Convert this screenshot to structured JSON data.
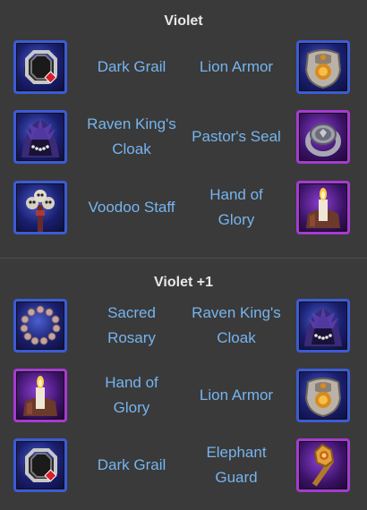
{
  "sections": [
    {
      "title": "Violet",
      "rows": [
        {
          "left": {
            "name": "Dark Grail",
            "icon": "dark-grail-icon",
            "rarity_color": "#3c5bd8"
          },
          "right": {
            "name": "Lion Armor",
            "icon": "lion-armor-icon",
            "rarity_color": "#3c5bd8"
          }
        },
        {
          "left": {
            "name": "Raven King's\nCloak",
            "icon": "raven-kings-cloak-icon",
            "rarity_color": "#3c5bd8"
          },
          "right": {
            "name": "Pastor's Seal",
            "icon": "pastors-seal-icon",
            "rarity_color": "#a63ad3"
          }
        },
        {
          "left": {
            "name": "Voodoo Staff",
            "icon": "voodoo-staff-icon",
            "rarity_color": "#3c5bd8"
          },
          "right": {
            "name": "Hand of\nGlory",
            "icon": "hand-of-glory-icon",
            "rarity_color": "#a63ad3"
          }
        }
      ]
    },
    {
      "title": "Violet +1",
      "rows": [
        {
          "left": {
            "name": "Sacred\nRosary",
            "icon": "sacred-rosary-icon",
            "rarity_color": "#3c5bd8"
          },
          "right": {
            "name": "Raven King's\nCloak",
            "icon": "raven-kings-cloak-icon",
            "rarity_color": "#3c5bd8"
          }
        },
        {
          "left": {
            "name": "Hand of\nGlory",
            "icon": "hand-of-glory-icon",
            "rarity_color": "#a63ad3"
          },
          "right": {
            "name": "Lion Armor",
            "icon": "lion-armor-icon",
            "rarity_color": "#3c5bd8"
          }
        },
        {
          "left": {
            "name": "Dark Grail",
            "icon": "dark-grail-icon",
            "rarity_color": "#3c5bd8"
          },
          "right": {
            "name": "Elephant\nGuard",
            "icon": "elephant-guard-icon",
            "rarity_color": "#a63ad3"
          }
        }
      ]
    }
  ]
}
